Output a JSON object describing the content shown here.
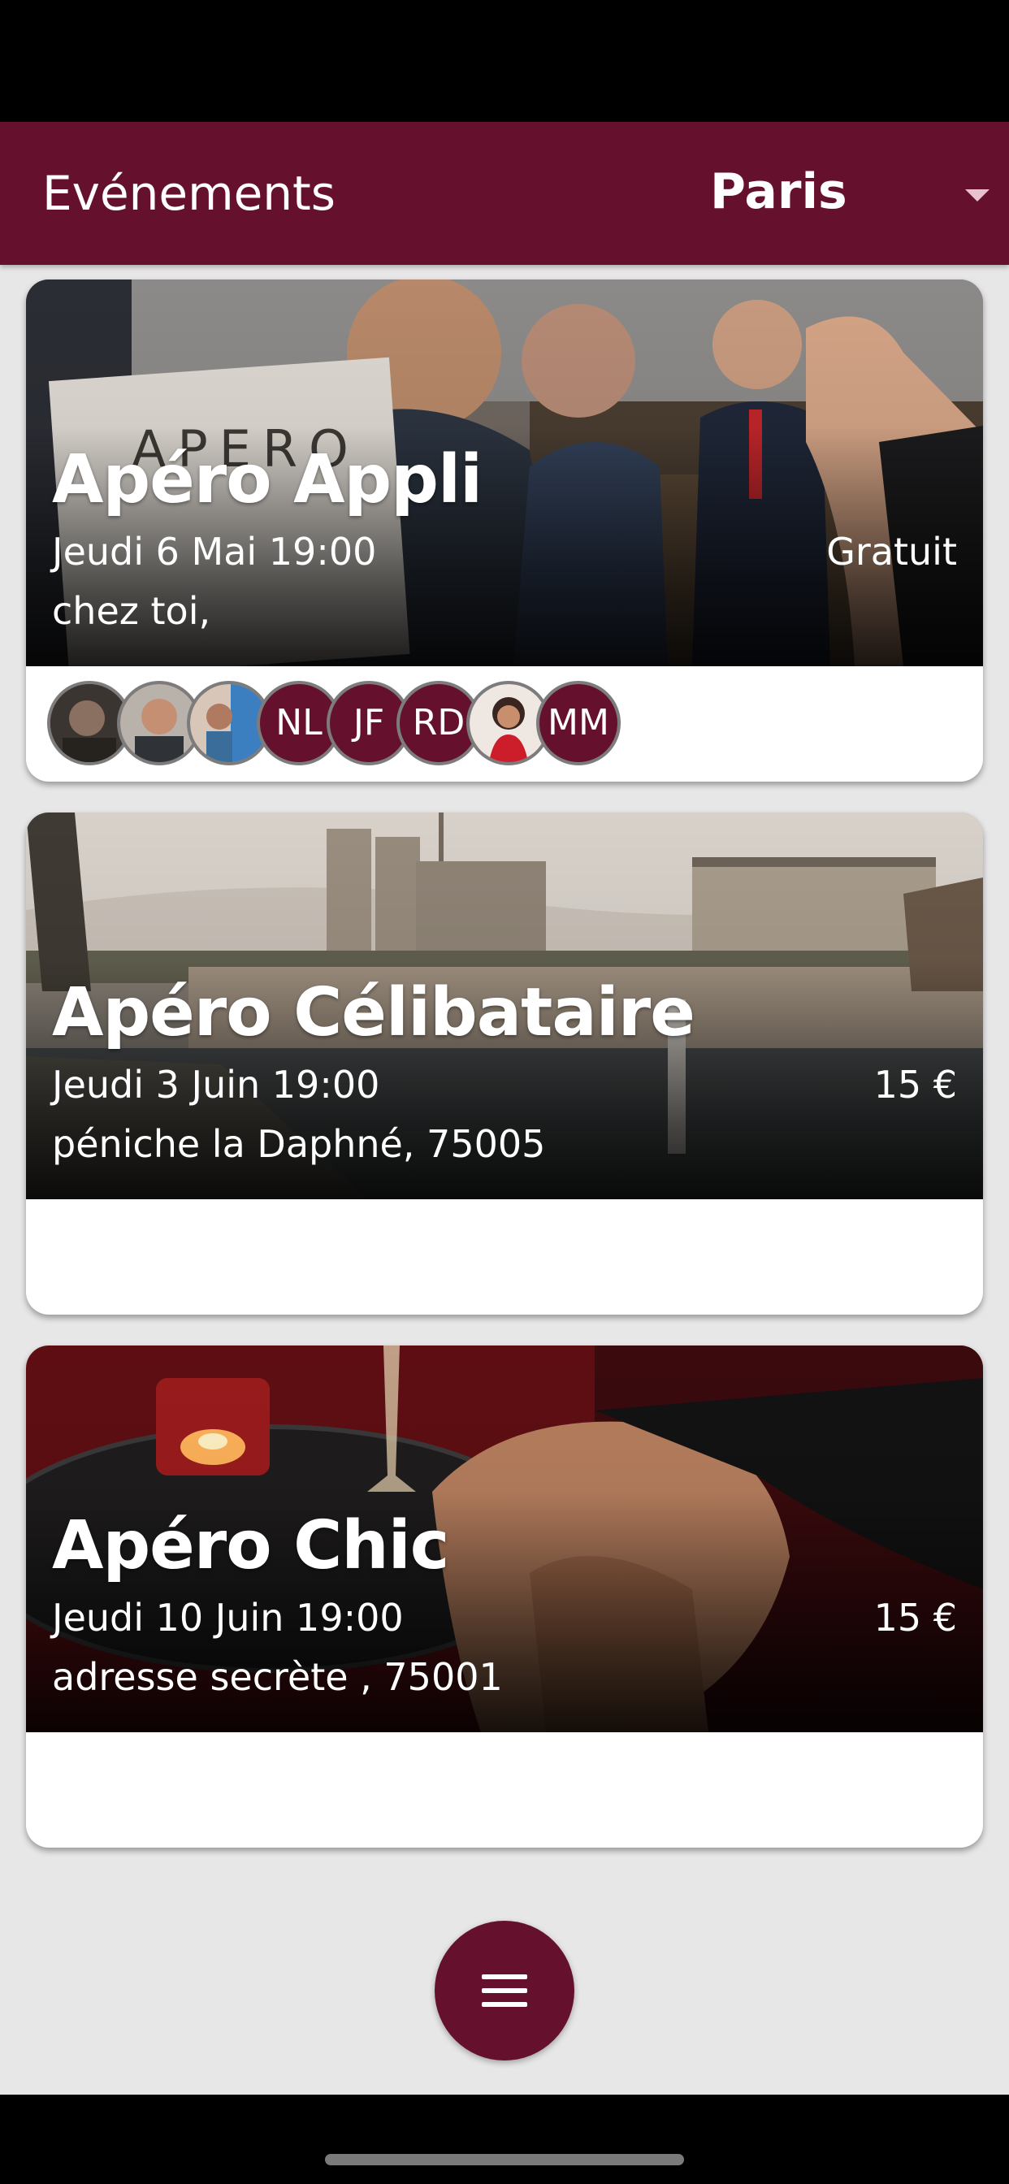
{
  "header": {
    "title": "Evénements",
    "city": "Paris"
  },
  "events": [
    {
      "title": "Apéro Appli",
      "date": "Jeudi 6 Mai 19:00",
      "price": "Gratuit",
      "place": "chez toi,",
      "attendees": [
        {
          "type": "photo"
        },
        {
          "type": "photo"
        },
        {
          "type": "photo"
        },
        {
          "type": "initials",
          "label": "NL"
        },
        {
          "type": "initials",
          "label": "JF"
        },
        {
          "type": "initials",
          "label": "RD"
        },
        {
          "type": "photo"
        },
        {
          "type": "initials",
          "label": "MM"
        }
      ]
    },
    {
      "title": "Apéro Célibataire",
      "date": "Jeudi 3 Juin 19:00",
      "price": "15 €",
      "place": "péniche la Daphné, 75005",
      "attendees": []
    },
    {
      "title": "Apéro Chic",
      "date": "Jeudi 10 Juin 19:00",
      "price": "15 €",
      "place": "adresse secrète , 75001",
      "attendees": []
    }
  ],
  "colors": {
    "primary": "#65102c",
    "background": "#e8e7e8"
  },
  "icons": {
    "dropdown": "triangle-down-icon",
    "menu": "menu-icon"
  }
}
